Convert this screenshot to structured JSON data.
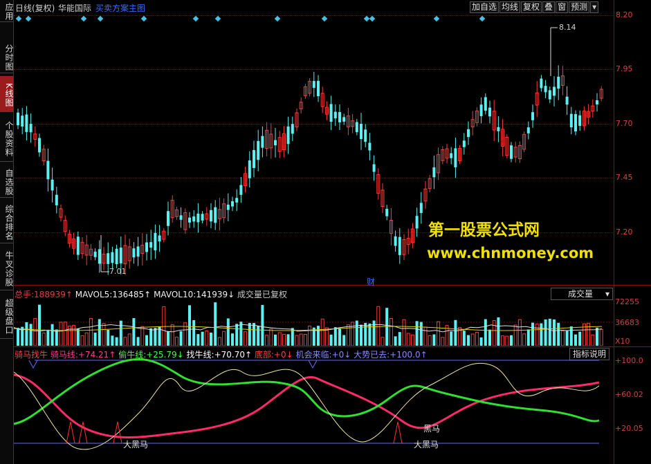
{
  "sidebar": {
    "tabs": [
      {
        "label": "应用",
        "active": false
      },
      {
        "label": "分时图",
        "active": false
      },
      {
        "label": "K线图",
        "active": true
      },
      {
        "label": "个股资料",
        "active": false
      },
      {
        "label": "自选股",
        "active": false
      },
      {
        "label": "综合排名",
        "active": false
      },
      {
        "label": "牛叉诊股",
        "active": false
      },
      {
        "label": "超级盘口",
        "active": false
      }
    ]
  },
  "header": {
    "period": "日线(复权)",
    "stock_name": "华能国际",
    "overlay": "买卖方案主图",
    "buttons": [
      "加自选",
      "均线",
      "复权",
      "叠",
      "窗",
      "预测"
    ],
    "dropdown_icon": "triangle-down"
  },
  "price_chart": {
    "y_ticks": [
      "8.20",
      "7.95",
      "7.70",
      "7.45",
      "7.20"
    ],
    "high_label": "8.14",
    "low_label": "7.01",
    "marker_label": "财",
    "up_color": "#ff3a3a",
    "down_color": "#5cf0f0"
  },
  "watermark": {
    "line1": "第一股票公式网",
    "line2": "www.chnmoney.com"
  },
  "volume_panel": {
    "total_label": "总手:",
    "total_value": "188939↑",
    "mavol5_label": "MAVOL5:",
    "mavol5_value": "136485↑",
    "mavol10_label": "MAVOL10:",
    "mavol10_value": "141939↓",
    "note": "成交量已复权",
    "selector": "成交量",
    "y_ticks": [
      "72255",
      "36683",
      "X10"
    ]
  },
  "indicator_panel": {
    "name": "骑马找牛",
    "items": [
      {
        "label": "骑马线:",
        "value": "+74.21↑",
        "color": "#ff3a8a"
      },
      {
        "label": "偷牛线:",
        "value": "+25.79↓",
        "color": "#40ff40"
      },
      {
        "label": "找牛线:",
        "value": "+70.70↑",
        "color": "#ffffff"
      },
      {
        "label": "底部:",
        "value": "+0↓",
        "color": "#ff4040"
      },
      {
        "label": "机会来临:",
        "value": "+0↓",
        "color": "#6a6aff"
      },
      {
        "label": "大势已去:",
        "value": "+100.0↑",
        "color": "#8a8aff"
      }
    ],
    "help_button": "指标说明",
    "y_ticks": [
      "+100.0",
      "+60.02",
      "+20.05"
    ],
    "annotations": [
      "大黑马",
      "黑马",
      "大黑马"
    ]
  }
}
